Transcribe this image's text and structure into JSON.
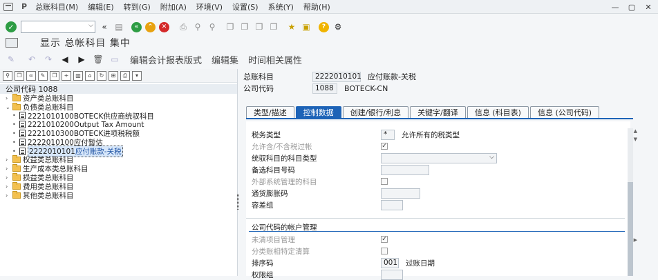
{
  "menu": [
    "总账科目(M)",
    "编辑(E)",
    "转到(G)",
    "附加(A)",
    "环境(V)",
    "设置(S)",
    "系统(Y)",
    "帮助(H)"
  ],
  "menu_p_icon": "P",
  "title": "显示 总帐科目 集中",
  "app_toolbar": {
    "layout": "编辑会计报表版式",
    "edit_set": "编辑集",
    "time_attr": "时间相关属性"
  },
  "tree": {
    "header": "公司代码 1088",
    "nodes": [
      {
        "level": 0,
        "type": "folder",
        "expanded": false,
        "label": "资产类总账科目"
      },
      {
        "level": 0,
        "type": "folder",
        "expanded": true,
        "label": "负债类总账科目"
      },
      {
        "level": 1,
        "type": "doc",
        "label_code": "2221010100",
        "label_text": "BOTECK供应商统驭科目"
      },
      {
        "level": 1,
        "type": "doc",
        "label_code": "2221010200",
        "label_text": "Output Tax Amount"
      },
      {
        "level": 1,
        "type": "doc",
        "label_code": "2221010300",
        "label_text": "BOTECK进项税税额"
      },
      {
        "level": 1,
        "type": "doc",
        "label_code": "2222010100",
        "label_text": "应付暂估"
      },
      {
        "level": 1,
        "type": "doc",
        "selected": true,
        "label_code": "2222010101",
        "label_text": "应付账款-关税"
      },
      {
        "level": 0,
        "type": "folder",
        "expanded": false,
        "label": "权益类总账科目"
      },
      {
        "level": 0,
        "type": "folder",
        "expanded": false,
        "label": "生产成本类总账科目"
      },
      {
        "level": 0,
        "type": "folder",
        "expanded": false,
        "label": "损益类总账科目"
      },
      {
        "level": 0,
        "type": "folder",
        "expanded": false,
        "label": "费用类总账科目"
      },
      {
        "level": 0,
        "type": "folder",
        "expanded": false,
        "label": "其他类总账科目"
      }
    ]
  },
  "header_fields": {
    "gl_account": {
      "label": "总账科目",
      "value": "2222010101",
      "desc": "应付账款-关税"
    },
    "company_code": {
      "label": "公司代码",
      "value": "1088",
      "desc": "BOTECK-CN"
    }
  },
  "tabs": [
    "类型/描述",
    "控制数据",
    "创建/银行/利息",
    "关键字/翻译",
    "信息 (科目表)",
    "信息 (公司代码)"
  ],
  "active_tab": 1,
  "fields": {
    "tax_category": {
      "label": "税务类型",
      "value": "*",
      "desc": "允许所有的税类型"
    },
    "tax_not_required": {
      "label": "允许含/不含税过帐",
      "checked": true
    },
    "recon_type": {
      "label": "统驭科目的科目类型",
      "value": ""
    },
    "alt_account": {
      "label": "备选科目号码",
      "value": ""
    },
    "ext_managed": {
      "label": "外部系统管理的科目",
      "checked": false
    },
    "inflation_key": {
      "label": "通货膨胀码",
      "value": ""
    },
    "tolerance_group": {
      "label": "容差组",
      "value": ""
    }
  },
  "account_mgmt": {
    "title": "公司代码的帐户管理",
    "open_item": {
      "label": "未清项目管理",
      "checked": true
    },
    "ledger_specific": {
      "label": "分类账相特定清算",
      "checked": false
    },
    "sort_key": {
      "label": "排序码",
      "value": "001",
      "desc": "过账日期"
    },
    "auth_group": {
      "label": "权限组",
      "value": ""
    }
  }
}
